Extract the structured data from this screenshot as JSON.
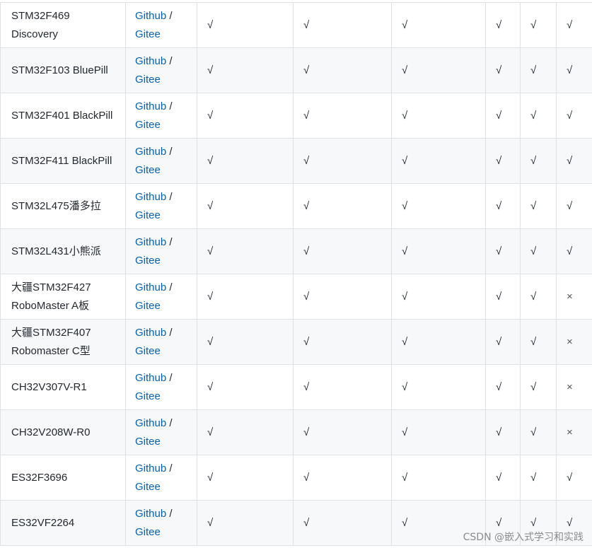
{
  "rows": [
    {
      "board": "STM32F469 Discovery",
      "link1": "Github",
      "sep": " /",
      "link2": "Gitee",
      "marks": [
        "√",
        "√",
        "√",
        "√",
        "√",
        "√"
      ]
    },
    {
      "board": "STM32F103 BluePill",
      "link1": "Github",
      "sep": " /",
      "link2": "Gitee",
      "marks": [
        "√",
        "√",
        "√",
        "√",
        "√",
        "√"
      ]
    },
    {
      "board": "STM32F401 BlackPill",
      "link1": "Github",
      "sep": " /",
      "link2": "Gitee",
      "marks": [
        "√",
        "√",
        "√",
        "√",
        "√",
        "√"
      ]
    },
    {
      "board": "STM32F411 BlackPill",
      "link1": "Github",
      "sep": " /",
      "link2": "Gitee",
      "marks": [
        "√",
        "√",
        "√",
        "√",
        "√",
        "√"
      ]
    },
    {
      "board": "STM32L475潘多拉",
      "link1": "Github",
      "sep": " /",
      "link2": "Gitee",
      "marks": [
        "√",
        "√",
        "√",
        "√",
        "√",
        "√"
      ]
    },
    {
      "board": "STM32L431小熊派",
      "link1": "Github",
      "sep": " /",
      "link2": "Gitee",
      "marks": [
        "√",
        "√",
        "√",
        "√",
        "√",
        "√"
      ]
    },
    {
      "board": "大疆STM32F427 RoboMaster A板",
      "link1": "Github",
      "sep": " /",
      "link2": "Gitee",
      "marks": [
        "√",
        "√",
        "√",
        "√",
        "√",
        "×"
      ]
    },
    {
      "board": "大疆STM32F407 Robomaster C型",
      "link1": "Github",
      "sep": " /",
      "link2": "Gitee",
      "marks": [
        "√",
        "√",
        "√",
        "√",
        "√",
        "×"
      ]
    },
    {
      "board": "CH32V307V-R1",
      "link1": "Github",
      "sep": " /",
      "link2": "Gitee",
      "marks": [
        "√",
        "√",
        "√",
        "√",
        "√",
        "×"
      ]
    },
    {
      "board": "CH32V208W-R0",
      "link1": "Github",
      "sep": " /",
      "link2": "Gitee",
      "marks": [
        "√",
        "√",
        "√",
        "√",
        "√",
        "×"
      ]
    },
    {
      "board": "ES32F3696",
      "link1": "Github",
      "sep": " /",
      "link2": "Gitee",
      "marks": [
        "√",
        "√",
        "√",
        "√",
        "√",
        "√"
      ]
    },
    {
      "board": "ES32VF2264",
      "link1": "Github",
      "sep": " /",
      "link2": "Gitee",
      "marks": [
        "√",
        "√",
        "√",
        "√",
        "√",
        "√"
      ]
    }
  ],
  "watermark": "CSDN @嵌入式学习和实践"
}
